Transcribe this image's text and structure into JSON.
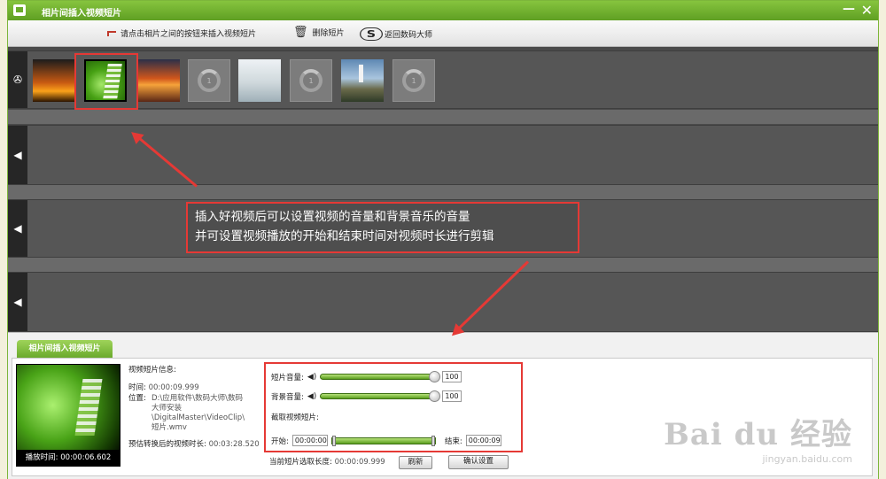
{
  "window": {
    "title": "相片间插入视频短片",
    "min_glyph": "—",
    "close_glyph": "✕"
  },
  "toolbar": {
    "insert_hint": "请点击相片之间的按钮来插入视频短片",
    "delete_label": "删除短片",
    "back_label": "返回数码大师",
    "back_glyph": "S"
  },
  "timeline": {
    "track_icons": [
      "reel-icon",
      "arrow-left-icon",
      "arrow-left-icon",
      "arrow-left-icon"
    ],
    "slots": [
      "photo-couple-sunset",
      "video-clip-selected",
      "insert-placeholder",
      "photo-sunset-sea",
      "insert-placeholder",
      "photo-snowy-rocks",
      "insert-placeholder",
      "photo-lighthouse",
      "insert-placeholder"
    ],
    "placeholder_glyph": "1"
  },
  "annotation": {
    "line1": "插入好视频后可以设置视频的音量和背景音乐的音量",
    "line2": "并可设置视频播放的开始和结束时间对视频时长进行剪辑"
  },
  "panel": {
    "tab_label": "相片间插入视频短片",
    "preview_caption": "播放时间: 00:00:06.602",
    "info_title": "视频短片信息:",
    "time_label": "时间:",
    "time_value": "00:00:09.999",
    "location_label": "位置:",
    "location_value": [
      "D:\\应用软件\\数码大师\\数码",
      "大师安装",
      "\\DigitalMaster\\VideoClip\\",
      "短片.wmv"
    ],
    "estimate_label": "预估转换后的视频时长:",
    "estimate_value": "00:03:28.520",
    "clip_volume_label": "短片音量:",
    "clip_volume_value": "100",
    "bg_volume_label": "背景音量:",
    "bg_volume_value": "100",
    "cut_label": "截取视频短片:",
    "start_label": "开始:",
    "start_value": "00:00:00",
    "end_label": "结束:",
    "end_value": "00:00:09",
    "selected_length_label": "当前短片选取长度:",
    "selected_length_value": "00:00:09.999",
    "refresh_button": "刷新",
    "confirm_button": "确认设置",
    "speaker_glyph": "◀)"
  },
  "watermark": {
    "brand": "Bai du 经验",
    "url": "jingyan.baidu.com"
  },
  "colors": {
    "accent_green": "#6aab2c",
    "highlight_red": "#e53935"
  }
}
